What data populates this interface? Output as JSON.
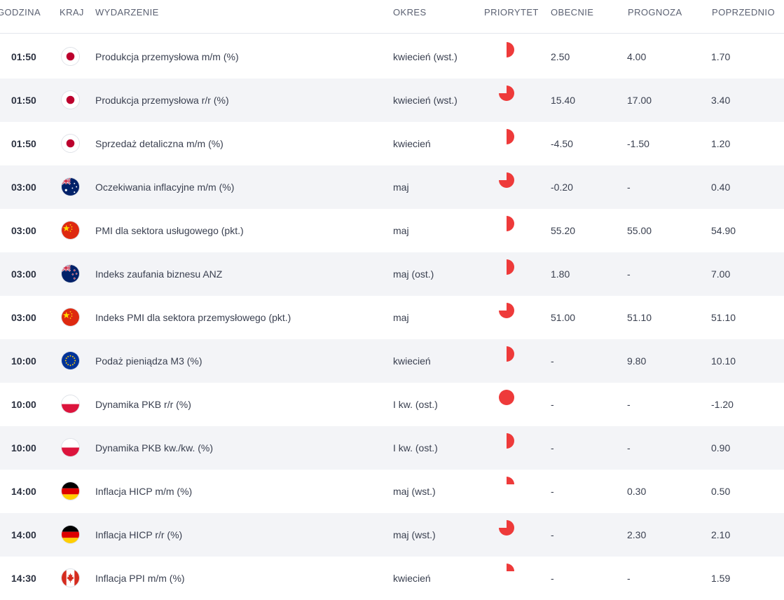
{
  "headers": {
    "time": "GODZINA",
    "country": "KRAJ",
    "event": "WYDARZENIE",
    "period": "OKRES",
    "priority": "PRIORYTET",
    "actual": "OBECNIE",
    "forecast": "PROGNOZA",
    "previous": "POPRZEDNIO"
  },
  "colors": {
    "priority": "#ee3a3a",
    "row_alt": "#f3f4f7"
  },
  "rows": [
    {
      "time": "01:50",
      "country": "japan-flag",
      "event": "Produkcja przemysłowa m/m (%)",
      "period": "kwiecień (wst.)",
      "priority": 0.5,
      "actual": "2.50",
      "forecast": "4.00",
      "previous": "1.70"
    },
    {
      "time": "01:50",
      "country": "japan-flag",
      "event": "Produkcja przemysłowa r/r (%)",
      "period": "kwiecień (wst.)",
      "priority": 0.75,
      "actual": "15.40",
      "forecast": "17.00",
      "previous": "3.40"
    },
    {
      "time": "01:50",
      "country": "japan-flag",
      "event": "Sprzedaż detaliczna m/m (%)",
      "period": "kwiecień",
      "priority": 0.5,
      "actual": "-4.50",
      "forecast": "-1.50",
      "previous": "1.20"
    },
    {
      "time": "03:00",
      "country": "australia-flag",
      "event": "Oczekiwania inflacyjne m/m (%)",
      "period": "maj",
      "priority": 0.75,
      "actual": "-0.20",
      "forecast": "-",
      "previous": "0.40"
    },
    {
      "time": "03:00",
      "country": "china-flag",
      "event": "PMI dla sektora usługowego (pkt.)",
      "period": "maj",
      "priority": 0.5,
      "actual": "55.20",
      "forecast": "55.00",
      "previous": "54.90"
    },
    {
      "time": "03:00",
      "country": "new-zealand-flag",
      "event": "Indeks zaufania biznesu ANZ",
      "period": "maj (ost.)",
      "priority": 0.5,
      "actual": "1.80",
      "forecast": "-",
      "previous": "7.00"
    },
    {
      "time": "03:00",
      "country": "china-flag",
      "event": "Indeks PMI dla sektora przemysłowego (pkt.)",
      "period": "maj",
      "priority": 0.75,
      "actual": "51.00",
      "forecast": "51.10",
      "previous": "51.10"
    },
    {
      "time": "10:00",
      "country": "eu-flag",
      "event": "Podaż pieniądza M3 (%)",
      "period": "kwiecień",
      "priority": 0.5,
      "actual": "-",
      "forecast": "9.80",
      "previous": "10.10"
    },
    {
      "time": "10:00",
      "country": "poland-flag",
      "event": "Dynamika PKB r/r (%)",
      "period": "I kw. (ost.)",
      "priority": 1.0,
      "actual": "-",
      "forecast": "-",
      "previous": "-1.20"
    },
    {
      "time": "10:00",
      "country": "poland-flag",
      "event": "Dynamika PKB kw./kw. (%)",
      "period": "I kw. (ost.)",
      "priority": 0.5,
      "actual": "-",
      "forecast": "-",
      "previous": "0.90"
    },
    {
      "time": "14:00",
      "country": "germany-flag",
      "event": "Inflacja HICP m/m (%)",
      "period": "maj (wst.)",
      "priority": 0.25,
      "actual": "-",
      "forecast": "0.30",
      "previous": "0.50"
    },
    {
      "time": "14:00",
      "country": "germany-flag",
      "event": "Inflacja HICP r/r (%)",
      "period": "maj (wst.)",
      "priority": 0.75,
      "actual": "-",
      "forecast": "2.30",
      "previous": "2.10"
    },
    {
      "time": "14:30",
      "country": "canada-flag",
      "event": "Inflacja PPI m/m (%)",
      "period": "kwiecień",
      "priority": 0.25,
      "actual": "-",
      "forecast": "-",
      "previous": "1.59"
    }
  ]
}
